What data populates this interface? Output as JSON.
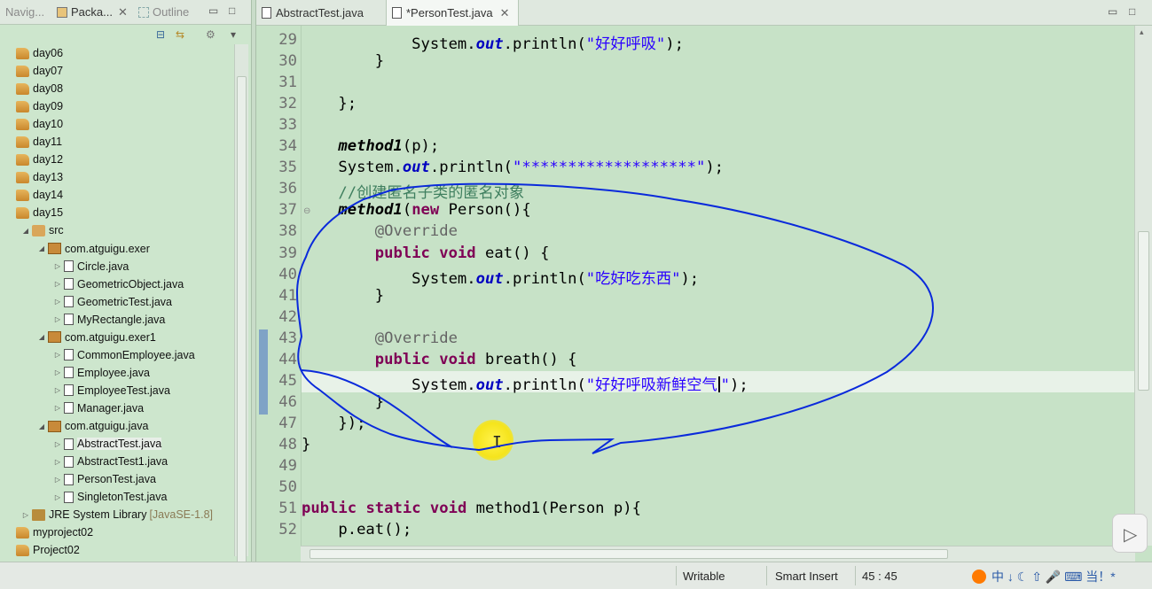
{
  "left_panel": {
    "tabs": [
      {
        "label": "Navig..."
      },
      {
        "label": "Packa..."
      },
      {
        "label": "Outline"
      }
    ],
    "tree": [
      {
        "label": "day06",
        "type": "project",
        "indent": 0
      },
      {
        "label": "day07",
        "type": "project",
        "indent": 0
      },
      {
        "label": "day08",
        "type": "project",
        "indent": 0
      },
      {
        "label": "day09",
        "type": "project",
        "indent": 0
      },
      {
        "label": "day10",
        "type": "project",
        "indent": 0
      },
      {
        "label": "day11",
        "type": "project",
        "indent": 0
      },
      {
        "label": "day12",
        "type": "project",
        "indent": 0
      },
      {
        "label": "day13",
        "type": "project",
        "indent": 0
      },
      {
        "label": "day14",
        "type": "project",
        "indent": 0
      },
      {
        "label": "day15",
        "type": "project",
        "indent": 0
      },
      {
        "label": "src",
        "type": "src",
        "indent": 1,
        "arrow": "◢"
      },
      {
        "label": "com.atguigu.exer",
        "type": "package",
        "indent": 2,
        "arrow": "◢"
      },
      {
        "label": "Circle.java",
        "type": "file",
        "indent": 3,
        "arrow": "▷"
      },
      {
        "label": "GeometricObject.java",
        "type": "file",
        "indent": 3,
        "arrow": "▷"
      },
      {
        "label": "GeometricTest.java",
        "type": "file",
        "indent": 3,
        "arrow": "▷"
      },
      {
        "label": "MyRectangle.java",
        "type": "file",
        "indent": 3,
        "arrow": "▷"
      },
      {
        "label": "com.atguigu.exer1",
        "type": "package",
        "indent": 2,
        "arrow": "◢"
      },
      {
        "label": "CommonEmployee.java",
        "type": "file",
        "indent": 3,
        "arrow": "▷"
      },
      {
        "label": "Employee.java",
        "type": "file",
        "indent": 3,
        "arrow": "▷"
      },
      {
        "label": "EmployeeTest.java",
        "type": "file",
        "indent": 3,
        "arrow": "▷"
      },
      {
        "label": "Manager.java",
        "type": "file",
        "indent": 3,
        "arrow": "▷"
      },
      {
        "label": "com.atguigu.java",
        "type": "package",
        "indent": 2,
        "arrow": "◢"
      },
      {
        "label": "AbstractTest.java",
        "type": "file",
        "indent": 3,
        "arrow": "▷",
        "selected": true
      },
      {
        "label": "AbstractTest1.java",
        "type": "file",
        "indent": 3,
        "arrow": "▷"
      },
      {
        "label": "PersonTest.java",
        "type": "file",
        "indent": 3,
        "arrow": "▷"
      },
      {
        "label": "SingletonTest.java",
        "type": "file",
        "indent": 3,
        "arrow": "▷"
      },
      {
        "label": "JRE System Library",
        "type": "library",
        "indent": 1,
        "arrow": "▷",
        "sub": "[JavaSE-1.8]"
      },
      {
        "label": "myproject02",
        "type": "project",
        "indent": 0
      },
      {
        "label": "Project02",
        "type": "project",
        "indent": 0
      }
    ]
  },
  "editor": {
    "tabs": [
      {
        "label": "AbstractTest.java",
        "active": false
      },
      {
        "label": "*PersonTest.java",
        "active": true,
        "close": "✕"
      }
    ],
    "lines": [
      {
        "n": "29",
        "tokens": [
          [
            "",
            "            System."
          ],
          [
            "fld",
            "out"
          ],
          [
            "",
            ".println("
          ],
          [
            "str",
            "\"好好呼吸\""
          ],
          [
            "",
            ");"
          ]
        ]
      },
      {
        "n": "30",
        "tokens": [
          [
            "",
            "        }"
          ]
        ]
      },
      {
        "n": "31",
        "tokens": [
          [
            "",
            ""
          ]
        ]
      },
      {
        "n": "32",
        "tokens": [
          [
            "",
            "    };"
          ]
        ]
      },
      {
        "n": "33",
        "tokens": [
          [
            "",
            ""
          ]
        ]
      },
      {
        "n": "34",
        "tokens": [
          [
            "",
            "    "
          ],
          [
            "mi",
            "method1"
          ],
          [
            "",
            "(p);"
          ]
        ]
      },
      {
        "n": "35",
        "tokens": [
          [
            "",
            "    System."
          ],
          [
            "fld",
            "out"
          ],
          [
            "",
            ".println("
          ],
          [
            "str",
            "\"*******************\""
          ],
          [
            "",
            ");"
          ]
        ]
      },
      {
        "n": "36",
        "tokens": [
          [
            "",
            "    "
          ],
          [
            "cmt",
            "//创建匿名子类的匿名对象"
          ]
        ]
      },
      {
        "n": "37",
        "fold": "⊖",
        "tokens": [
          [
            "",
            "    "
          ],
          [
            "mi",
            "method1"
          ],
          [
            "",
            "("
          ],
          [
            "kw",
            "new"
          ],
          [
            "",
            " Person(){"
          ]
        ]
      },
      {
        "n": "38",
        "tokens": [
          [
            "",
            "        "
          ],
          [
            "ann",
            "@Override"
          ]
        ]
      },
      {
        "n": "39",
        "tokens": [
          [
            "",
            "        "
          ],
          [
            "kw",
            "public"
          ],
          [
            "",
            " "
          ],
          [
            "kw",
            "void"
          ],
          [
            "",
            " eat() {"
          ]
        ]
      },
      {
        "n": "40",
        "tokens": [
          [
            "",
            "            System."
          ],
          [
            "fld",
            "out"
          ],
          [
            "",
            ".println("
          ],
          [
            "str",
            "\"吃好吃东西\""
          ],
          [
            "",
            ");"
          ]
        ]
      },
      {
        "n": "41",
        "tokens": [
          [
            "",
            "        }"
          ]
        ]
      },
      {
        "n": "42",
        "tokens": [
          [
            "",
            ""
          ]
        ]
      },
      {
        "n": "43",
        "tokens": [
          [
            "",
            "        "
          ],
          [
            "ann",
            "@Override"
          ]
        ]
      },
      {
        "n": "44",
        "tokens": [
          [
            "",
            "        "
          ],
          [
            "kw",
            "public"
          ],
          [
            "",
            " "
          ],
          [
            "kw",
            "void"
          ],
          [
            "",
            " breath() {"
          ]
        ]
      },
      {
        "n": "45",
        "current": true,
        "tokens": [
          [
            "",
            "            System."
          ],
          [
            "fld",
            "out"
          ],
          [
            "",
            ".println("
          ],
          [
            "str",
            "\"好好呼吸新鲜空气"
          ],
          [
            "caret",
            ""
          ],
          [
            "str",
            "\""
          ],
          [
            "",
            ");"
          ]
        ]
      },
      {
        "n": "46",
        "tokens": [
          [
            "",
            "        }"
          ]
        ]
      },
      {
        "n": "47",
        "tokens": [
          [
            "",
            "    });"
          ]
        ]
      },
      {
        "n": "48",
        "tokens": [
          [
            "",
            "}"
          ]
        ]
      },
      {
        "n": "49",
        "tokens": [
          [
            "",
            ""
          ]
        ]
      },
      {
        "n": "50",
        "tokens": [
          [
            "",
            ""
          ]
        ]
      },
      {
        "n": "51",
        "fold": "⊖",
        "tokens": [
          [
            "kw",
            "public"
          ],
          [
            "",
            " "
          ],
          [
            "kw",
            "static"
          ],
          [
            "",
            " "
          ],
          [
            "kw",
            "void"
          ],
          [
            "",
            " method1(Person p){"
          ]
        ]
      },
      {
        "n": "52",
        "tokens": [
          [
            "",
            "    p.eat();"
          ]
        ]
      }
    ]
  },
  "status": {
    "writable": "Writable",
    "insert_mode": "Smart Insert",
    "position": "45 : 45",
    "ime_text": "中 ↓ ☾ ⇧ 🎤 ⌨ 当！*"
  },
  "colors": {
    "background": "#c7e2c7",
    "keyword": "#7f0055",
    "string": "#2a00ff",
    "annotation_pen": "#0a2adb"
  }
}
